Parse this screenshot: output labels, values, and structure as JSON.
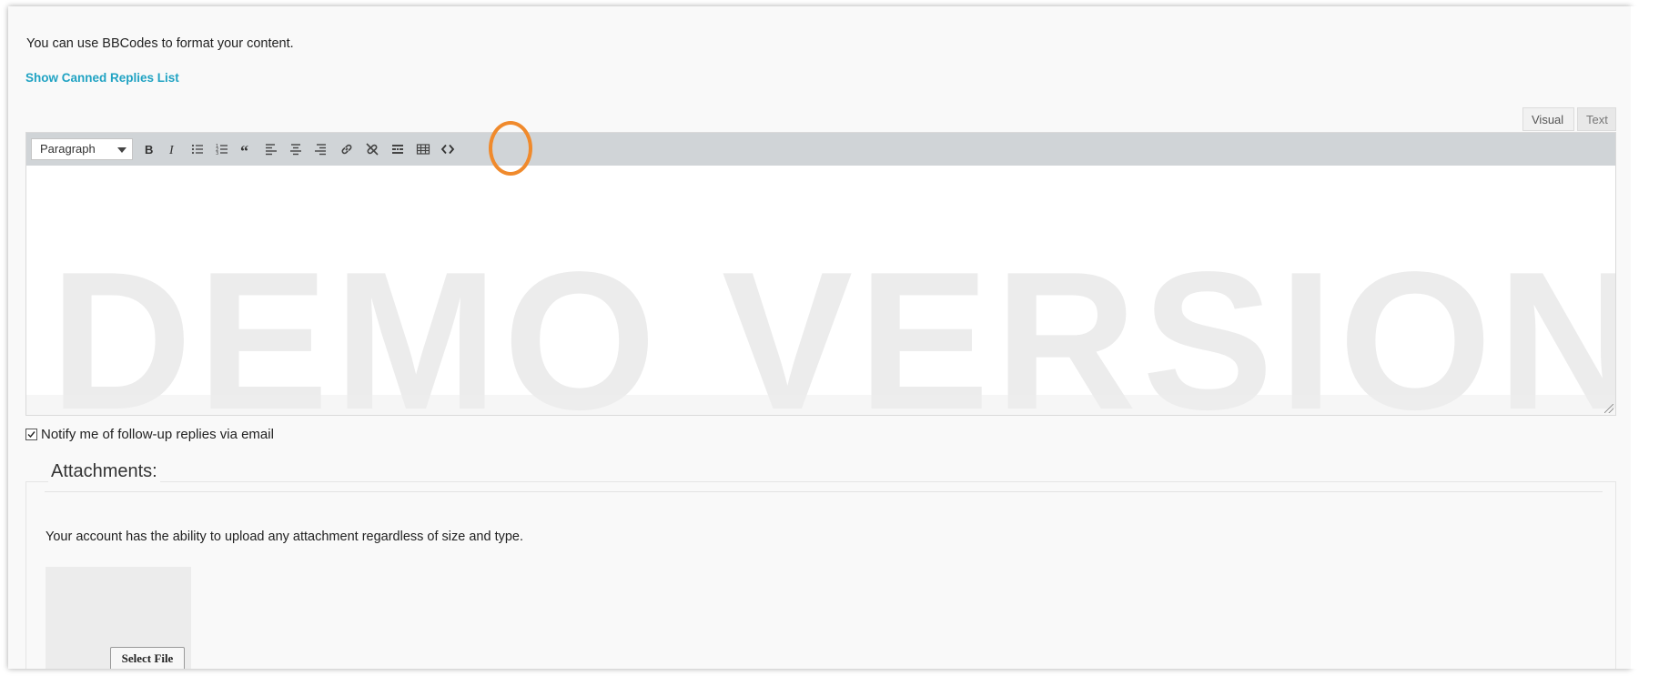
{
  "intro_text": "You can use BBCodes to format your content.",
  "canned_link": "Show Canned Replies List",
  "mode_tabs": {
    "visual": "Visual",
    "text": "Text"
  },
  "toolbar": {
    "format_value": "Paragraph",
    "buttons": [
      {
        "icon": "bold-icon"
      },
      {
        "icon": "italic-icon"
      },
      {
        "icon": "bulleted-list-icon"
      },
      {
        "icon": "numbered-list-icon"
      },
      {
        "icon": "blockquote-icon"
      },
      {
        "icon": "align-left-icon"
      },
      {
        "icon": "align-center-icon"
      },
      {
        "icon": "align-right-icon"
      },
      {
        "icon": "insert-link-icon"
      },
      {
        "icon": "remove-link-icon"
      },
      {
        "icon": "read-more-icon"
      },
      {
        "icon": "toolbar-toggle-icon"
      },
      {
        "icon": "code-icon"
      }
    ]
  },
  "watermark": "DEMO VERSION",
  "notify_label": "Notify me of follow-up replies via email",
  "notify_checked": true,
  "attachments": {
    "title": "Attachments:",
    "note": "Your account has the ability to upload any attachment regardless of size and type.",
    "select_file_label": "Select File"
  },
  "colors": {
    "link": "#21a3c3",
    "toolbar_bg": "#d0d4d7",
    "highlight_ring": "#f08a2c",
    "watermark": "#ececec"
  }
}
